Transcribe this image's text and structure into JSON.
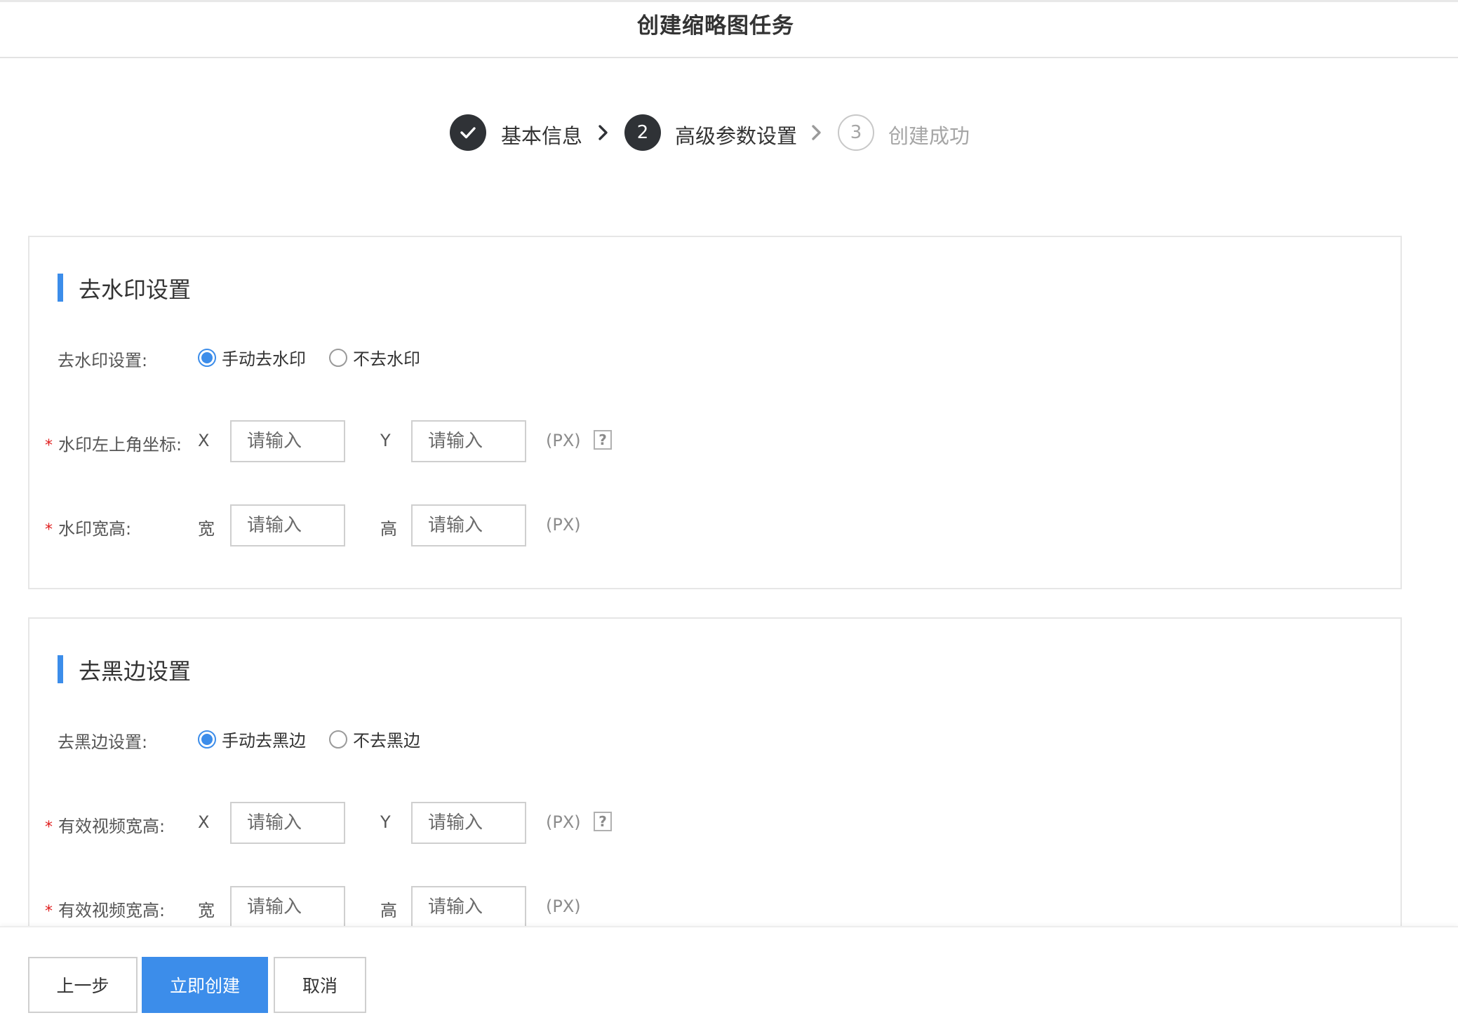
{
  "header": {
    "title": "创建缩略图任务"
  },
  "steps": [
    {
      "number": "",
      "label": "基本信息",
      "state": "done",
      "icon": "check-icon"
    },
    {
      "number": "2",
      "label": "高级参数设置",
      "state": "active"
    },
    {
      "number": "3",
      "label": "创建成功",
      "state": "pending"
    }
  ],
  "watermark": {
    "title": "去水印设置",
    "mode_label": "去水印设置:",
    "options": [
      {
        "label": "手动去水印",
        "checked": true
      },
      {
        "label": "不去水印",
        "checked": false
      }
    ],
    "coord_label": "水印左上角坐标:",
    "coord_x_label": "X",
    "coord_y_label": "Y",
    "coord_x_placeholder": "请输入",
    "coord_y_placeholder": "请输入",
    "coord_unit": "(PX)",
    "size_label": "水印宽高:",
    "width_label": "宽",
    "height_label": "高",
    "width_placeholder": "请输入",
    "height_placeholder": "请输入",
    "size_unit": "(PX)",
    "help": "?"
  },
  "blackborder": {
    "title": "去黑边设置",
    "mode_label": "去黑边设置:",
    "options": [
      {
        "label": "手动去黑边",
        "checked": true
      },
      {
        "label": "不去黑边",
        "checked": false
      }
    ],
    "coord_label": "有效视频宽高:",
    "coord_x_label": "X",
    "coord_y_label": "Y",
    "coord_x_placeholder": "请输入",
    "coord_y_placeholder": "请输入",
    "coord_unit": "(PX)",
    "size_label": "有效视频宽高:",
    "width_label": "宽",
    "height_label": "高",
    "width_placeholder": "请输入",
    "height_placeholder": "请输入",
    "size_unit": "(PX)",
    "help": "?"
  },
  "required_mark": "*",
  "footer": {
    "prev_label": "上一步",
    "create_label": "立即创建",
    "cancel_label": "取消"
  },
  "colors": {
    "accent": "#3c8dea",
    "step_dark": "#2f3236",
    "required": "#e02020"
  }
}
